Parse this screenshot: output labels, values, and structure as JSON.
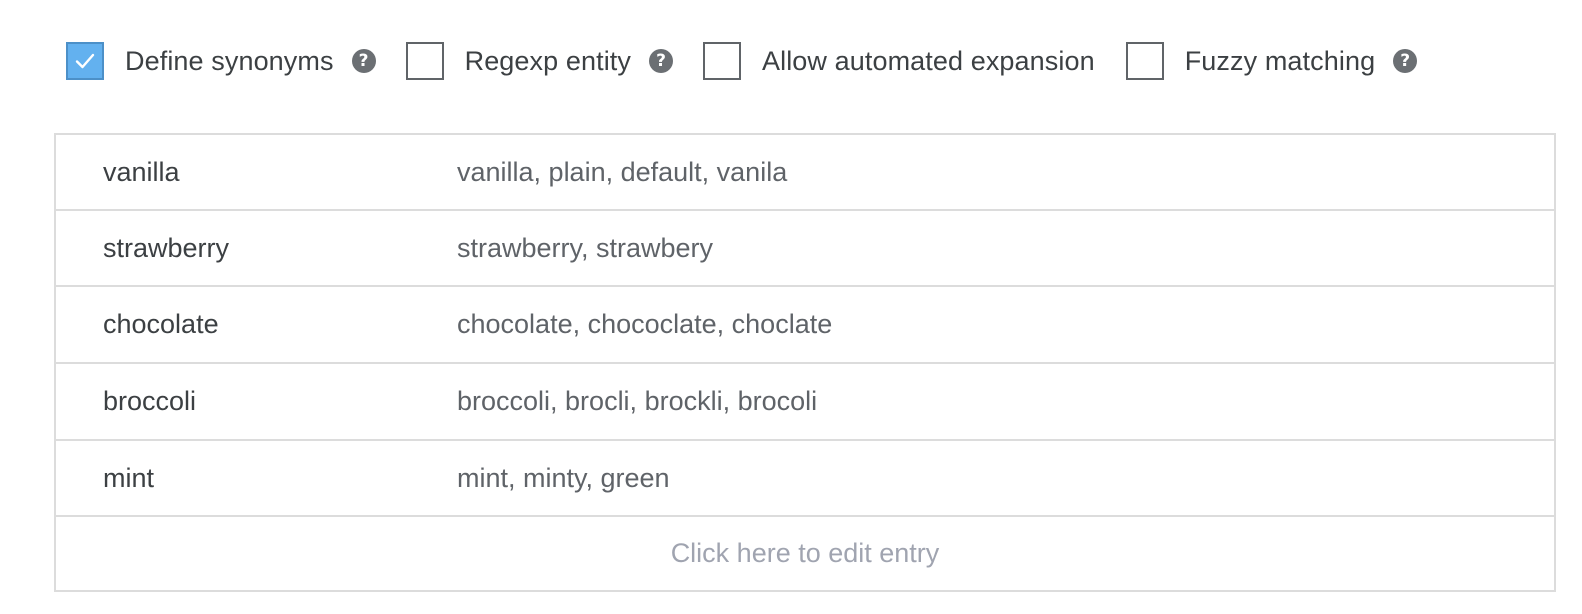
{
  "options": [
    {
      "label": "Define synonyms",
      "checked": true,
      "help": true
    },
    {
      "label": "Regexp entity",
      "checked": false,
      "help": true
    },
    {
      "label": "Allow automated expansion",
      "checked": false,
      "help": false
    },
    {
      "label": "Fuzzy matching",
      "checked": false,
      "help": true
    }
  ],
  "entries": [
    {
      "value": "vanilla",
      "synonyms": "vanilla, plain, default, vanila"
    },
    {
      "value": "strawberry",
      "synonyms": "strawberry, strawbery"
    },
    {
      "value": "chocolate",
      "synonyms": "chocolate, chococlate, choclate"
    },
    {
      "value": "broccoli",
      "synonyms": "broccoli, brocli, brockli, brocoli"
    },
    {
      "value": "mint",
      "synonyms": "mint, minty, green"
    }
  ],
  "edit_entry_label": "Click here to edit entry",
  "icons": {
    "check": "check-icon",
    "help": "question-circle-icon"
  },
  "colors": {
    "checked_fill": "#63b1ef",
    "placeholder_text": "#a0a4b0"
  }
}
